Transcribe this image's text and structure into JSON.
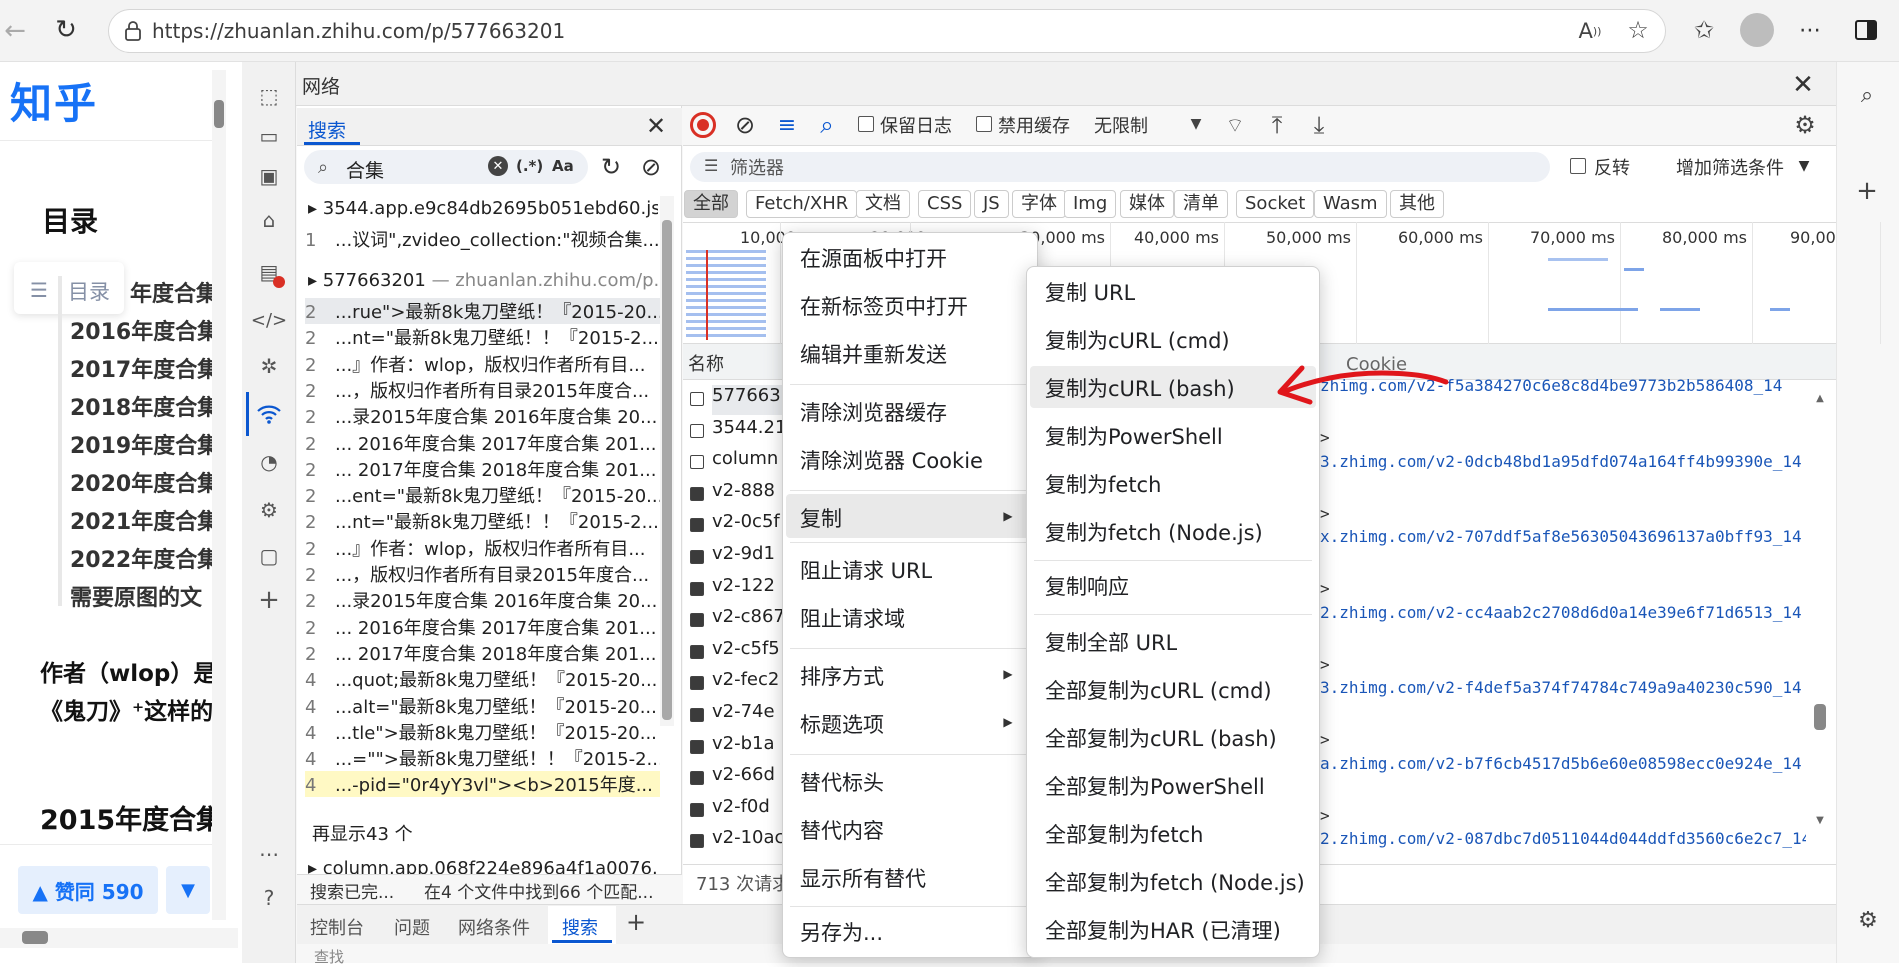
{
  "browser": {
    "url": "https://zhuanlan.zhihu.com/p/577663201"
  },
  "zhihu": {
    "logo": "知乎",
    "toc_heading": "目录",
    "toc_float_label": "目录",
    "toc_items": [
      "年度合集",
      "2016年度合集",
      "2017年度合集",
      "2018年度合集",
      "2019年度合集",
      "2020年度合集",
      "2021年度合集",
      "2022年度合集",
      "需要原图的文"
    ],
    "author_line": "作者（wlop）是",
    "ref_line": "《鬼刀》⁺这样的",
    "section_heading": "2015年度合集",
    "like_label": "▲ 赞同 590",
    "down_label": "▼"
  },
  "devtools": {
    "panel_title": "网络",
    "search": {
      "tab_label": "搜索",
      "query": "合集",
      "regex_btn": "(.*)",
      "case_btn": "Aa",
      "file1_name": "3544.app.e9c84db2695b051ebd60.js...",
      "file1_line_num": "1",
      "file1_line": "...议词\",zvideo_collection:\"视频合集...",
      "file2_name": "577663201",
      "file2_host": "— zhuanlan.zhihu.com/p...",
      "results": [
        {
          "n": "2",
          "text": "...rue\">最新8k鬼刀壁纸！『2015-20..."
        },
        {
          "n": "2",
          "text": "...nt=\"最新8k鬼刀壁纸！！『2015-2..."
        },
        {
          "n": "2",
          "text": "...』作者：wlop，版权归作者所有目..."
        },
        {
          "n": "2",
          "text": "...，版权归作者所有目录2015年度合..."
        },
        {
          "n": "2",
          "text": "...录2015年度合集 2016年度合集 20..."
        },
        {
          "n": "2",
          "text": "... 2016年度合集 2017年度合集 201..."
        },
        {
          "n": "2",
          "text": "... 2017年度合集 2018年度合集 201..."
        },
        {
          "n": "2",
          "text": "...ent=\"最新8k鬼刀壁纸！『2015-20..."
        },
        {
          "n": "2",
          "text": "...nt=\"最新8k鬼刀壁纸！！『2015-2..."
        },
        {
          "n": "2",
          "text": "...』作者：wlop，版权归作者所有目..."
        },
        {
          "n": "2",
          "text": "...，版权归作者所有目录2015年度合..."
        },
        {
          "n": "2",
          "text": "...录2015年度合集 2016年度合集 20..."
        },
        {
          "n": "2",
          "text": "... 2016年度合集 2017年度合集 201..."
        },
        {
          "n": "2",
          "text": "... 2017年度合集 2018年度合集 201..."
        },
        {
          "n": "4",
          "text": "...quot;最新8k鬼刀壁纸！『2015-20..."
        },
        {
          "n": "4",
          "text": "...alt=\"最新8k鬼刀壁纸！『2015-20..."
        },
        {
          "n": "4",
          "text": "...tle\">最新8k鬼刀壁纸！『2015-20..."
        },
        {
          "n": "4",
          "text": "...=\"\">最新8k鬼刀壁纸！！『2015-2..."
        },
        {
          "n": "4",
          "text": "...-pid=\"0r4yY3vl\"><b>2015年度..."
        }
      ],
      "show_more": "再显示43 个",
      "file3_name": "column.app.068f224e896a4f1a0076.j...",
      "status": "搜索已完...",
      "status_count": "在4 个文件中找到66 个匹配..."
    },
    "network": {
      "preserve_log": "保留日志",
      "disable_cache": "禁用缓存",
      "throttle": "无限制",
      "filter_placeholder": "筛选器",
      "invert": "反转",
      "more_filters": "增加筛选条件",
      "filters": [
        "全部",
        "Fetch/XHR",
        "文档",
        "CSS",
        "JS",
        "字体",
        "Img",
        "媒体",
        "清单",
        "Socket",
        "Wasm",
        "其他"
      ],
      "timeline_ticks": [
        "10,000",
        "20,000",
        "30,000 ms",
        "40,000 ms",
        "50,000 ms",
        "60,000 ms",
        "70,000 ms",
        "80,000 ms",
        "90,00"
      ],
      "name_header": "名称",
      "cookie_header": "Cookie",
      "names": [
        "577663",
        "3544.21",
        "column",
        "v2-888",
        "v2-0c5f",
        "v2-9d1",
        "v2-122",
        "v2-c867",
        "v2-c5f5",
        "v2-fec2",
        "v2-74e",
        "v2-b1a",
        "v2-66d",
        "v2-f0d",
        "v2-10ac"
      ],
      "url_lines": [
        "zhimg.com/v2-f5a384270c6e8c8d4be9773b2b586408_14",
        "3.zhimg.com/v2-0dcb48bd1a95dfd074a164ff4b99390e_14",
        "x.zhimg.com/v2-707ddf5af8e56305043696137a0bff93_14",
        "2.zhimg.com/v2-cc4aab2c2708d6d0a14e39e6f71d6513_14",
        "3.zhimg.com/v2-f4def5a374f74784c749a9a40230c590_14",
        "a.zhimg.com/v2-b7f6cb4517d5b6e60e08598ecc0e924e_14",
        "2.zhimg.com/v2-087dbc7d0511044d044ddfd3560c6e2c7_14"
      ],
      "gt": ">",
      "requests_footer": "713 次请求"
    },
    "bottom_tabs": [
      "控制台",
      "问题",
      "网络条件",
      "搜索"
    ],
    "bottom_more": "查找"
  },
  "context_menu": {
    "items_a": [
      "在源面板中打开",
      "在新标签页中打开",
      "编辑并重新发送"
    ],
    "items_b": [
      "清除浏览器缓存",
      "清除浏览器 Cookie"
    ],
    "copy": "复制",
    "items_c": [
      "阻止请求 URL",
      "阻止请求域"
    ],
    "sort": "排序方式",
    "header_opts": "标题选项",
    "items_d": [
      "替代标头",
      "替代内容",
      "显示所有替代"
    ],
    "save_as": "另存为..."
  },
  "copy_submenu": {
    "items_a": [
      "复制 URL",
      "复制为cURL (cmd)",
      "复制为cURL (bash)",
      "复制为PowerShell",
      "复制为fetch",
      "复制为fetch (Node.js)"
    ],
    "copy_response": "复制响应",
    "items_b": [
      "复制全部 URL",
      "全部复制为cURL (cmd)",
      "全部复制为cURL (bash)",
      "全部复制为PowerShell",
      "全部复制为fetch",
      "全部复制为fetch (Node.js)",
      "全部复制为HAR (已清理)"
    ]
  },
  "colors": {
    "zhihu_blue": "#1772f6",
    "annotation_red": "#e0161b",
    "link_blue": "#1a56b8"
  }
}
